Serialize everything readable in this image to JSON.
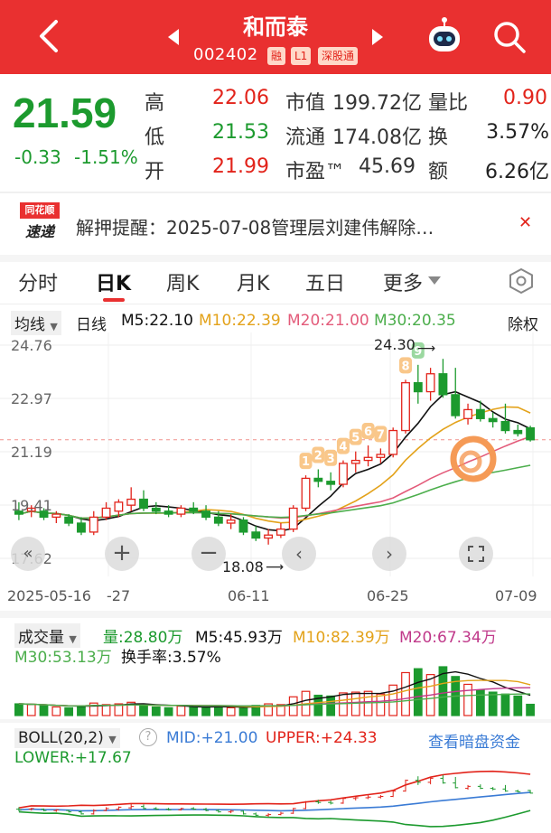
{
  "header": {
    "title": "和而泰",
    "code": "002402",
    "badges": [
      "融",
      "L1",
      "深股通"
    ]
  },
  "quote": {
    "price": "21.59",
    "change": "-0.33",
    "change_pct": "-1.51%",
    "high_label": "高",
    "high": "22.06",
    "low_label": "低",
    "low": "21.53",
    "open_label": "开",
    "open": "21.99",
    "mcap_label": "市值",
    "mcap": "199.72亿",
    "float_label": "流通",
    "float": "174.08亿",
    "pe_label": "市盈™",
    "pe": "45.69",
    "vr_label": "量比",
    "vr": "0.90",
    "turnover_label": "换",
    "turnover": "3.57%",
    "amount_label": "额",
    "amount": "6.26亿"
  },
  "notice": {
    "logo_top": "同花顺",
    "logo_bottom": "速递",
    "text": "解押提醒：2025-07-08管理层刘建伟解除…"
  },
  "tabs": [
    "分时",
    "日K",
    "周K",
    "月K",
    "五日",
    "更多"
  ],
  "active_tab": "日K",
  "ma_bar": {
    "type": "均线",
    "period": "日线",
    "m5": "M5:22.10",
    "m10": "M10:22.39",
    "m20": "M20:21.00",
    "m30": "M30:20.35",
    "fq": "除权"
  },
  "price_axis": [
    "24.76",
    "22.97",
    "21.19",
    "19.41",
    "17.62"
  ],
  "annotations": {
    "high": "24.30",
    "low": "18.08",
    "badge_numbers": [
      "1",
      "2",
      "3",
      "4",
      "5",
      "6",
      "7",
      "8",
      "9"
    ]
  },
  "date_axis": [
    "2025-05-16",
    "-27",
    "06-11",
    "06-25",
    "07-09"
  ],
  "volume": {
    "label": "成交量",
    "vol": "量:28.80万",
    "m5": "M5:45.93万",
    "m10": "M10:82.39万",
    "m20": "M20:67.34万",
    "m30": "M30:53.13万",
    "turnover": "换手率:3.57%"
  },
  "boll": {
    "label": "BOLL(20,2)",
    "mid": "MID:+21.00",
    "upper": "UPPER:+24.33",
    "lower": "LOWER:+17.67",
    "link": "查看暗盘资金"
  },
  "colors": {
    "up": "#e2231a",
    "down": "#1c9a2e",
    "ma5": "#111111",
    "ma10": "#e3a21a",
    "ma20": "#e35b7a",
    "ma30": "#4cae4c"
  },
  "chart_data": {
    "type": "candlestick",
    "ylim": [
      17.62,
      24.76
    ],
    "candles": [
      {
        "o": 19.2,
        "h": 19.5,
        "l": 18.9,
        "c": 19.1
      },
      {
        "o": 19.2,
        "h": 19.4,
        "l": 19.0,
        "c": 19.3
      },
      {
        "o": 19.2,
        "h": 19.3,
        "l": 18.9,
        "c": 19.0
      },
      {
        "o": 19.0,
        "h": 19.2,
        "l": 18.8,
        "c": 19.1
      },
      {
        "o": 19.0,
        "h": 19.1,
        "l": 18.7,
        "c": 18.8
      },
      {
        "o": 18.8,
        "h": 19.0,
        "l": 18.4,
        "c": 18.5
      },
      {
        "o": 18.5,
        "h": 19.2,
        "l": 18.4,
        "c": 19.0
      },
      {
        "o": 19.0,
        "h": 19.5,
        "l": 18.9,
        "c": 19.3
      },
      {
        "o": 19.2,
        "h": 19.6,
        "l": 19.0,
        "c": 19.5
      },
      {
        "o": 19.4,
        "h": 20.0,
        "l": 19.2,
        "c": 19.6
      },
      {
        "o": 19.6,
        "h": 19.9,
        "l": 19.2,
        "c": 19.3
      },
      {
        "o": 19.3,
        "h": 19.5,
        "l": 19.1,
        "c": 19.2
      },
      {
        "o": 19.2,
        "h": 19.4,
        "l": 19.0,
        "c": 19.1
      },
      {
        "o": 19.1,
        "h": 19.4,
        "l": 19.0,
        "c": 19.3
      },
      {
        "o": 19.3,
        "h": 19.5,
        "l": 19.1,
        "c": 19.2
      },
      {
        "o": 19.2,
        "h": 19.4,
        "l": 18.9,
        "c": 19.0
      },
      {
        "o": 19.0,
        "h": 19.2,
        "l": 18.7,
        "c": 18.8
      },
      {
        "o": 18.8,
        "h": 19.1,
        "l": 18.6,
        "c": 18.9
      },
      {
        "o": 18.9,
        "h": 19.0,
        "l": 18.4,
        "c": 18.5
      },
      {
        "o": 18.5,
        "h": 18.7,
        "l": 18.2,
        "c": 18.3
      },
      {
        "o": 18.3,
        "h": 18.6,
        "l": 18.08,
        "c": 18.4
      },
      {
        "o": 18.4,
        "h": 18.8,
        "l": 18.3,
        "c": 18.6
      },
      {
        "o": 18.6,
        "h": 19.4,
        "l": 18.5,
        "c": 19.3
      },
      {
        "o": 19.3,
        "h": 20.4,
        "l": 19.2,
        "c": 20.3
      },
      {
        "o": 20.3,
        "h": 20.6,
        "l": 20.0,
        "c": 20.2
      },
      {
        "o": 20.2,
        "h": 20.5,
        "l": 19.9,
        "c": 20.1
      },
      {
        "o": 20.1,
        "h": 20.9,
        "l": 20.0,
        "c": 20.8
      },
      {
        "o": 20.8,
        "h": 21.2,
        "l": 20.5,
        "c": 20.9
      },
      {
        "o": 20.9,
        "h": 21.4,
        "l": 20.7,
        "c": 21.0
      },
      {
        "o": 21.0,
        "h": 21.3,
        "l": 20.8,
        "c": 21.1
      },
      {
        "o": 21.1,
        "h": 22.0,
        "l": 21.0,
        "c": 21.9
      },
      {
        "o": 21.9,
        "h": 23.6,
        "l": 21.8,
        "c": 23.5
      },
      {
        "o": 23.5,
        "h": 24.1,
        "l": 22.8,
        "c": 23.2
      },
      {
        "o": 23.2,
        "h": 24.0,
        "l": 22.9,
        "c": 23.8
      },
      {
        "o": 23.8,
        "h": 24.3,
        "l": 23.0,
        "c": 23.1
      },
      {
        "o": 23.1,
        "h": 24.0,
        "l": 22.3,
        "c": 22.4
      },
      {
        "o": 22.3,
        "h": 22.8,
        "l": 22.1,
        "c": 22.6
      },
      {
        "o": 22.6,
        "h": 22.9,
        "l": 22.2,
        "c": 22.3
      },
      {
        "o": 22.3,
        "h": 22.5,
        "l": 22.0,
        "c": 22.2
      },
      {
        "o": 22.2,
        "h": 22.8,
        "l": 21.8,
        "c": 21.9
      },
      {
        "o": 21.9,
        "h": 22.1,
        "l": 21.7,
        "c": 21.8
      },
      {
        "o": 21.99,
        "h": 22.06,
        "l": 21.53,
        "c": 21.59
      }
    ],
    "volumes": [
      30,
      28,
      25,
      22,
      20,
      24,
      32,
      28,
      30,
      34,
      26,
      22,
      20,
      24,
      22,
      21,
      25,
      20,
      19,
      26,
      30,
      28,
      48,
      62,
      52,
      50,
      58,
      60,
      62,
      55,
      78,
      110,
      120,
      105,
      125,
      100,
      80,
      65,
      60,
      55,
      50,
      28.8
    ]
  }
}
